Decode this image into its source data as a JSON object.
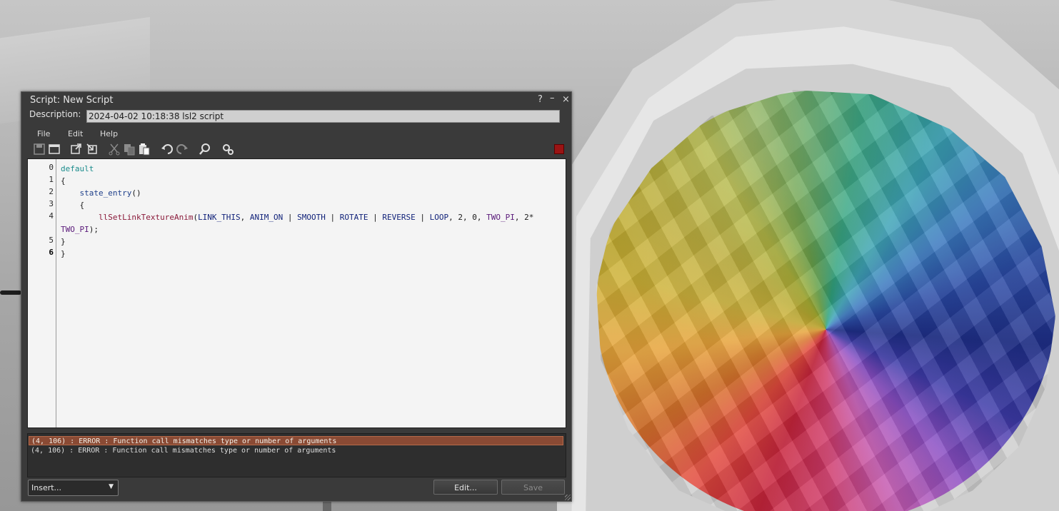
{
  "window": {
    "title": "Script: New Script",
    "help_glyph": "?",
    "minimize_glyph": "–",
    "close_glyph": "×"
  },
  "description": {
    "label": "Description:",
    "value": "2024-04-02 10:18:38 lsl2 script"
  },
  "menu": {
    "items": [
      "File",
      "Edit",
      "Help"
    ]
  },
  "toolbar": {
    "tools": [
      "save-icon",
      "window-icon",
      "external-editor-icon",
      "load-from-file-icon",
      "cut-icon",
      "copy-icon",
      "paste-icon",
      "undo-icon",
      "redo-icon",
      "search-icon",
      "settings-icon"
    ],
    "stop_color": "#9a1414"
  },
  "editor": {
    "line_numbers": [
      "0",
      "1",
      "2",
      "3",
      "4",
      "",
      "5",
      "6"
    ],
    "current_line": "6",
    "tokens": {
      "default": "default",
      "state_entry": "state_entry",
      "fn": "llSetLinkTextureAnim",
      "link_this": "LINK_THIS",
      "anim_on": "ANIM_ON",
      "smooth": "SMOOTH",
      "rotate": "ROTATE",
      "reverse": "REVERSE",
      "loop": "LOOP",
      "two_pi": "TWO_PI"
    },
    "colors": {
      "keyword": "#1a8c8c",
      "event": "#1e3f8a",
      "function": "#8a1a3a",
      "constant": "#12237a",
      "float_constant": "#5a1a7a"
    }
  },
  "errors": {
    "rows": [
      "(4, 106) : ERROR : Function call mismatches type or number of arguments",
      "(4, 106) : ERROR : Function call mismatches type or number of arguments"
    ],
    "selected_index": 0
  },
  "bottom": {
    "insert_label": "Insert...",
    "edit_label": "Edit...",
    "save_label": "Save"
  }
}
